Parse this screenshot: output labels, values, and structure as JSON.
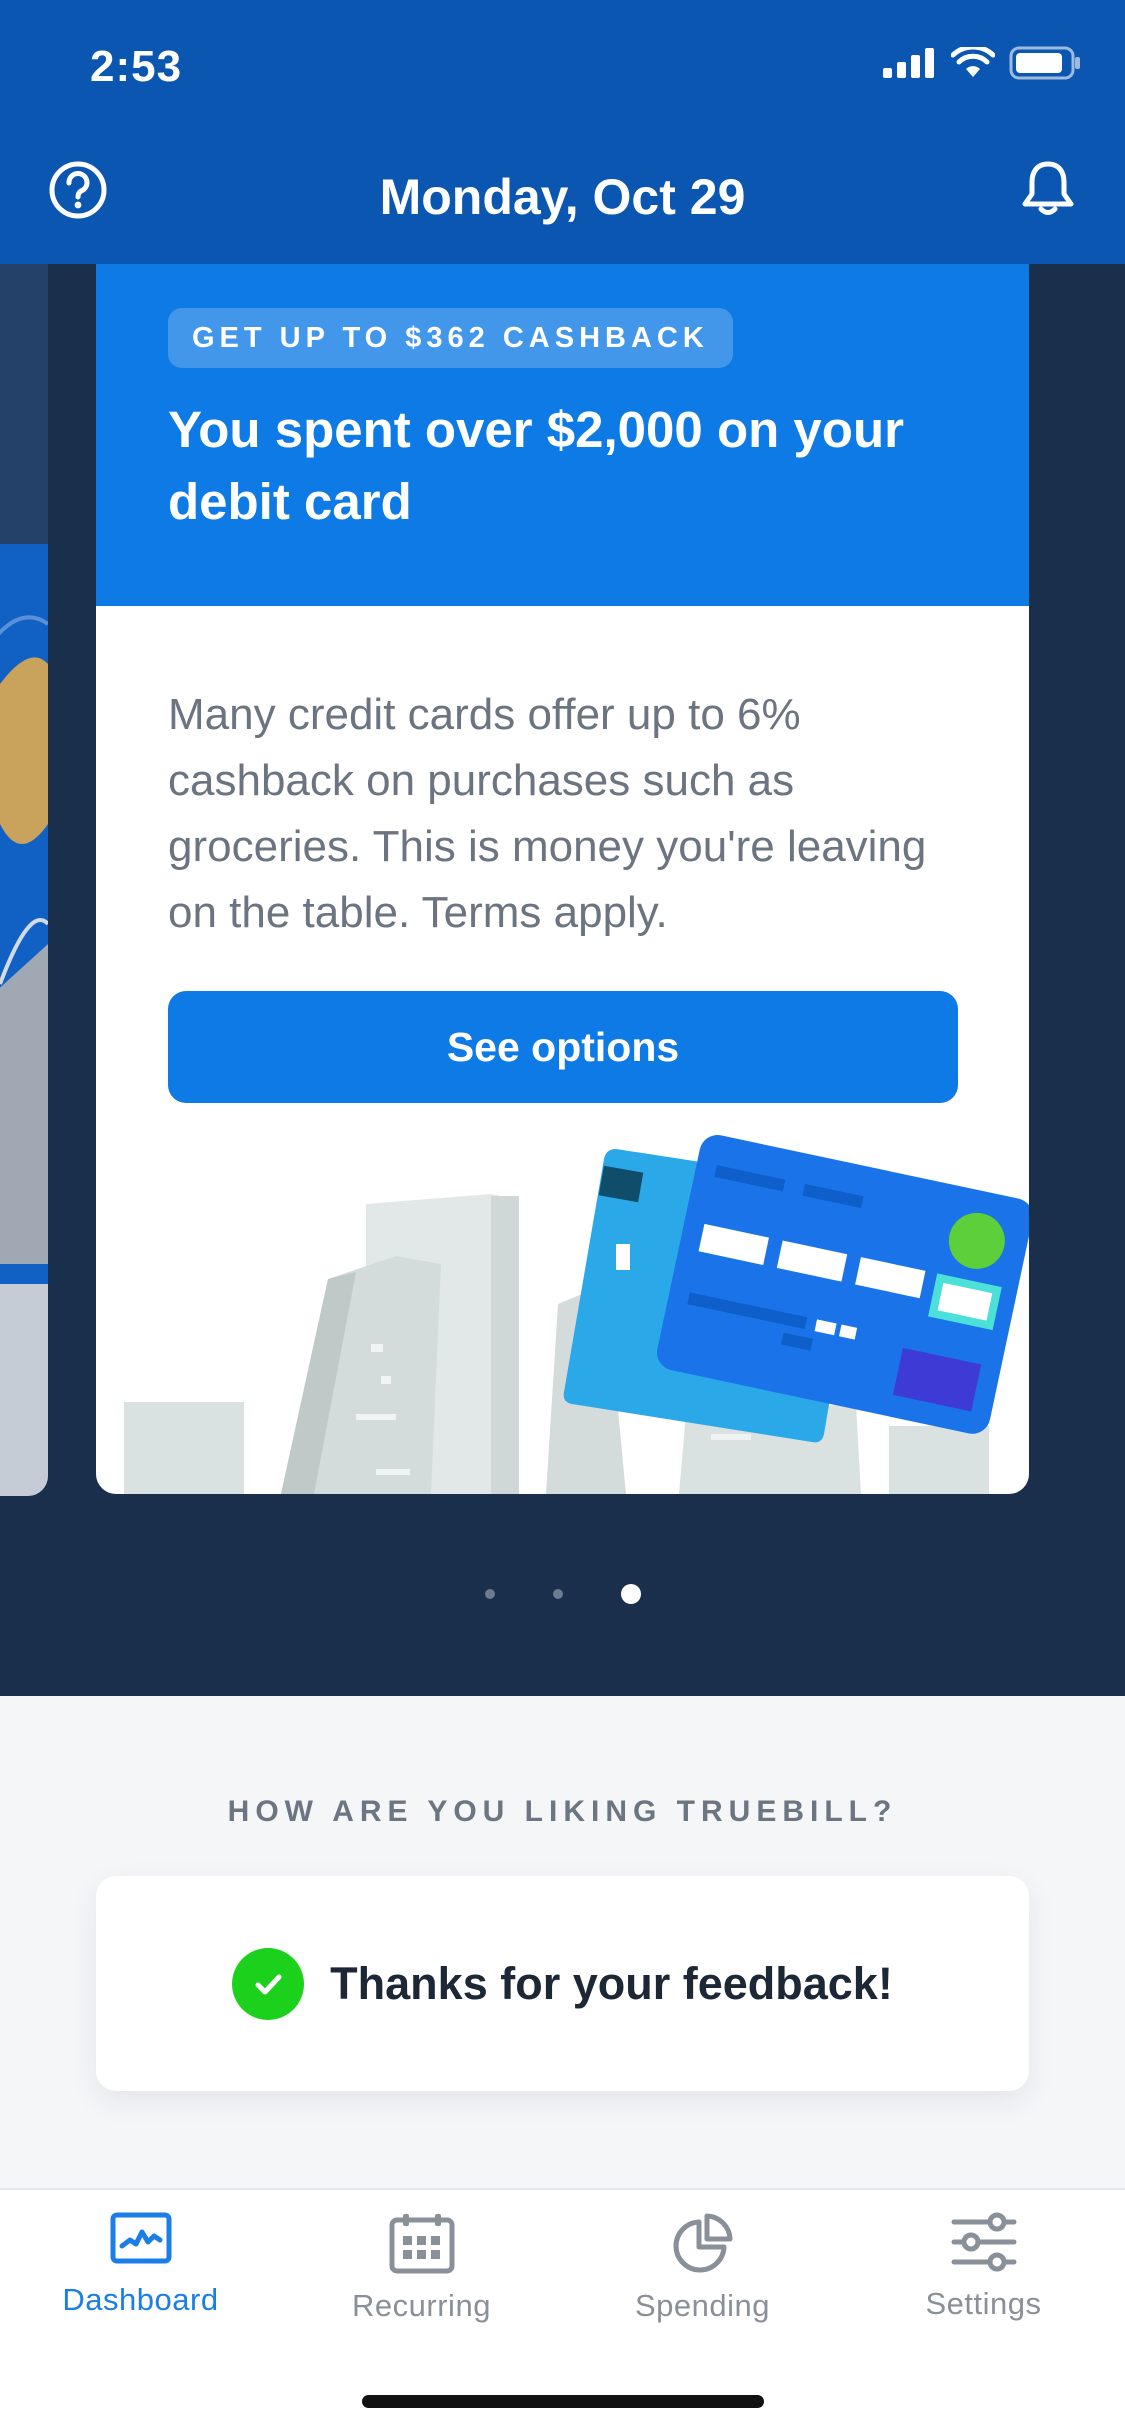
{
  "status_bar": {
    "time": "2:53"
  },
  "header": {
    "date": "Monday, Oct 29"
  },
  "card": {
    "badge": "GET UP TO $362 CASHBACK",
    "headline": "You spent over $2,000 on your debit card",
    "body": "Many credit cards offer up to 6% cashback on purchases such as groceries. This is money you're leaving on the table. Terms apply.",
    "cta_label": "See options"
  },
  "carousel": {
    "page_count": 3,
    "active_index": 2
  },
  "feedback": {
    "heading": "HOW ARE YOU LIKING TRUEBILL?",
    "message": "Thanks for your feedback!"
  },
  "tabs": [
    {
      "label": "Dashboard",
      "icon": "dashboard-icon",
      "active": true
    },
    {
      "label": "Recurring",
      "icon": "calendar-icon",
      "active": false
    },
    {
      "label": "Spending",
      "icon": "pie-chart-icon",
      "active": false
    },
    {
      "label": "Settings",
      "icon": "sliders-icon",
      "active": false
    }
  ],
  "colors": {
    "header_blue": "#0a56b0",
    "card_blue": "#0d7ae6",
    "dark_navy": "#1a2f4b",
    "success_green": "#1bd11b",
    "active_tab": "#1a7ee6"
  }
}
